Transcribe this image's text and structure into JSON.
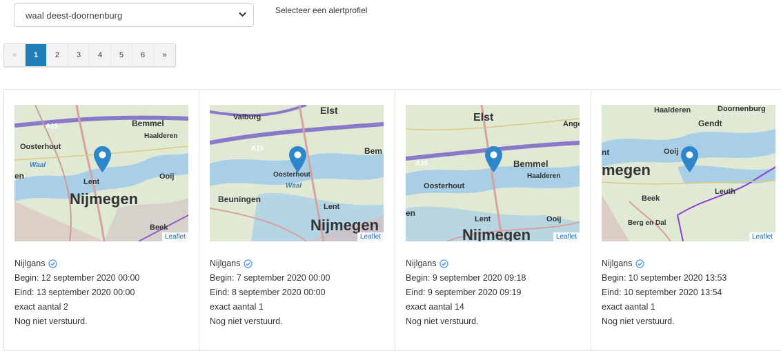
{
  "profile_select": {
    "value": "waal deest-doornenburg",
    "label": "Selecteer een alertprofiel"
  },
  "pagination": {
    "prev": "«",
    "pages": [
      "1",
      "2",
      "3",
      "4",
      "5",
      "6"
    ],
    "next": "»",
    "active": "1"
  },
  "map_attribution": "Leaflet",
  "cards": [
    {
      "species": "Nijlgans",
      "begin": "Begin: 12 september 2020 00:00",
      "end": "Eind: 13 september 2020 00:00",
      "count": "exact aantal 2",
      "status": "Nog niet verstuurd.",
      "map_labels": [
        "A15",
        "Bemmel",
        "Haalderen",
        "Oosterhout",
        "Lent",
        "Nijmegen",
        "Ooij",
        "Beek",
        "en",
        "Waal"
      ]
    },
    {
      "species": "Nijlgans",
      "begin": "Begin: 7 september 2020 00:00",
      "end": "Eind: 8 september 2020 00:00",
      "count": "exact aantal 1",
      "status": "Nog niet verstuurd.",
      "map_labels": [
        "Elst",
        "Valburg",
        "A15",
        "Bem",
        "Oosterhout",
        "Beuningen",
        "Lent",
        "Nijmegen",
        "Waal"
      ]
    },
    {
      "species": "Nijlgans",
      "begin": "Begin: 9 september 2020 09:18",
      "end": "Eind: 9 september 2020 09:19",
      "count": "exact aantal 14",
      "status": "Nog niet verstuurd.",
      "map_labels": [
        "Elst",
        "Ange",
        "A15",
        "Bemmel",
        "Haalderen",
        "Oosterhout",
        "Lent",
        "Ooij",
        "Nijmegen",
        "en"
      ]
    },
    {
      "species": "Nijlgans",
      "begin": "Begin: 10 september 2020 13:53",
      "end": "Eind: 10 september 2020 13:54",
      "count": "exact aantal 1",
      "status": "Nog niet verstuurd.",
      "map_labels": [
        "Haalderen",
        "Doornenburg",
        "Gendt",
        "Ooij",
        "nt",
        "megen",
        "Leuth",
        "Beek",
        "Berg en Dal"
      ]
    }
  ]
}
